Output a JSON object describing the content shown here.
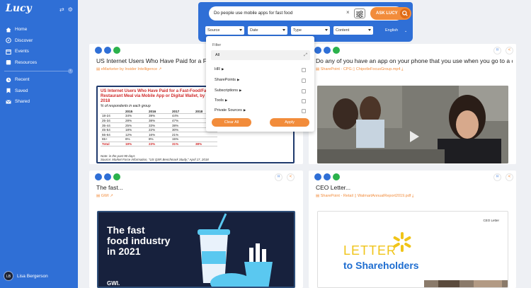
{
  "app": {
    "logo_text": "Lucy"
  },
  "sidebar": {
    "items": [
      {
        "label": "Home",
        "icon": "home-icon"
      },
      {
        "label": "Discover",
        "icon": "discover-icon"
      },
      {
        "label": "Events",
        "icon": "events-icon"
      },
      {
        "label": "Resources",
        "icon": "resources-icon"
      }
    ],
    "secondary_items": [
      {
        "label": "Recent",
        "icon": "clock-icon"
      },
      {
        "label": "Saved",
        "icon": "bookmark-icon"
      },
      {
        "label": "Shared",
        "icon": "mail-icon"
      }
    ],
    "user": {
      "initials": "LB",
      "name": "Lisa Bergerson"
    }
  },
  "search": {
    "query": "Do people use mobile apps for fast food",
    "clear_symbol": "×",
    "ask_label": "ASK LUCY",
    "filters": [
      {
        "label": "Source",
        "width": 55
      },
      {
        "label": "Date",
        "width": 55
      },
      {
        "label": "Type",
        "width": 55
      },
      {
        "label": "Content",
        "width": 55
      }
    ],
    "language": "English"
  },
  "filter_dropdown": {
    "title": "Filter",
    "all_label": "All",
    "rows": [
      "HR",
      "SharePoints",
      "Subscriptions",
      "Tools",
      "Private Sources"
    ],
    "clear_label": "Clear All",
    "apply_label": "Apply"
  },
  "cards": [
    {
      "title": "US Internet Users Who Have Paid for a Fast-",
      "source": "eMarketer by Insider Intelligence",
      "chart": {
        "title": "US Internet Users Who Have Paid for a Fast-Food/Fast-Casual Restaurant Meal via Mobile App or Digital Wallet, by Age, 2015-2018",
        "subtitle": "% of respondents in each group",
        "headers": [
          "",
          "2015",
          "2016",
          "2017",
          "2018"
        ],
        "rows": [
          [
            "18-24",
            "34%",
            "39%",
            "44%",
            ""
          ],
          [
            "25-34",
            "28%",
            "38%",
            "47%",
            ""
          ],
          [
            "35-44",
            "25%",
            "33%",
            "38%",
            ""
          ],
          [
            "45-54",
            "18%",
            "22%",
            "30%",
            ""
          ],
          [
            "55-64",
            "12%",
            "16%",
            "21%",
            ""
          ],
          [
            "65+",
            "6%",
            "8%",
            "15%",
            ""
          ]
        ],
        "total": [
          "Total",
          "19%",
          "23%",
          "31%",
          "38%"
        ],
        "note": "Note: in the past 90 days",
        "source": "Source: Market Force Information, \"US QSR Benchmark Study,\" April 17, 2018"
      }
    },
    {
      "title": "Do any of you have an app on your phone that you use when you go to a certai",
      "source_prefix": "SharePoint - CPG",
      "source_file": "ChipotleFocusGroup.mp4"
    },
    {
      "title": "The fast...",
      "source": "GWI",
      "gwi_lines": [
        "The fast",
        "food industry",
        "in 2021"
      ],
      "gwi_logo": "GWI."
    },
    {
      "title": "CEO Letter...",
      "source_prefix": "SharePoint - Retail",
      "source_file": "WalmartAnnualReport2019.pdf",
      "letter_head": "CEO Letter",
      "letter_line1": "LETTER",
      "letter_line2": "to Shareholders"
    }
  ],
  "colors": {
    "brand_blue": "#2f6fd6",
    "accent_orange": "#f28c3b",
    "positive_green": "#2bb24c"
  }
}
